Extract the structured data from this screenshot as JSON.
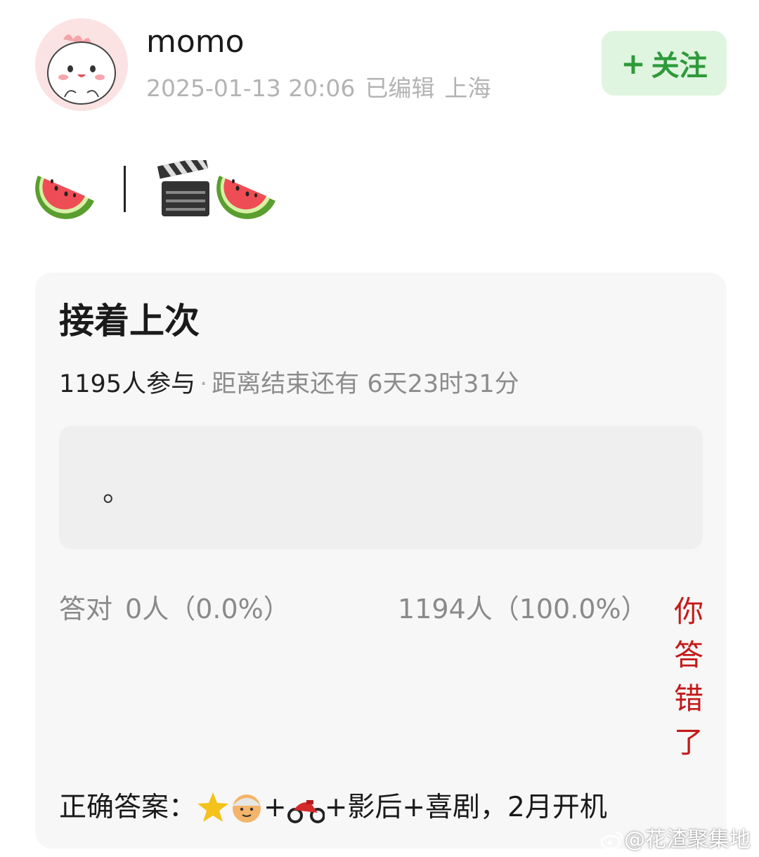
{
  "post": {
    "username": "momo",
    "date": "2025-01-13 20:06",
    "edited": "已编辑",
    "location": "上海",
    "follow_label": "关注",
    "follow_plus": "+",
    "emoji_row": [
      "watermelon-emoji",
      "divider",
      "clapper-board-emoji",
      "watermelon-emoji"
    ]
  },
  "quiz": {
    "title": "接着上次",
    "participants": "1195人参与",
    "separator": "·",
    "countdown": "距离结束还有 6天23时31分",
    "answer_text": "。",
    "correct_label": "答对",
    "correct_count": "0人（0.0%）",
    "wrong_count": "1194人（100.0%）",
    "wrong_badge": [
      "你",
      "答",
      "错",
      "了"
    ],
    "solution_label": "正确答案：",
    "solution_icons": [
      "star-emoji",
      "old-person-emoji"
    ],
    "solution_plus1": "+",
    "solution_icon2": "motorcycle-emoji",
    "solution_rest": "+影后+喜剧，2月开机"
  },
  "watermark": "@花渣聚集地",
  "colors": {
    "accent_green": "#2e9a3a",
    "follow_bg": "#dff5df",
    "wrong_red": "#c41a1a",
    "card_bg": "#f7f7f7"
  }
}
